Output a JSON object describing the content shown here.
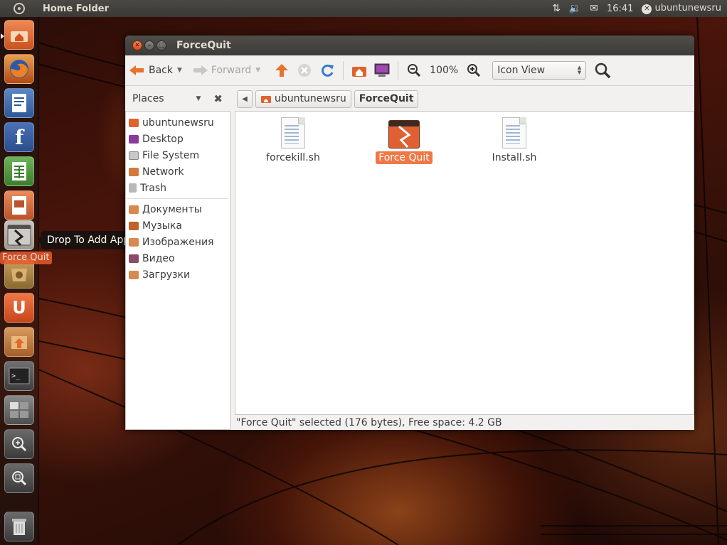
{
  "top_panel": {
    "title": "Home Folder",
    "time": "16:41",
    "user": "ubuntunewsru"
  },
  "launcher": {
    "tooltip": "Drop To Add Application",
    "drag_label": "Force Quit"
  },
  "window": {
    "title": "ForceQuit",
    "toolbar": {
      "back": "Back",
      "forward": "Forward",
      "zoom": "100%",
      "view": "Icon View"
    },
    "places_label": "Places",
    "breadcrumbs": [
      "ubuntunewsru",
      "ForceQuit"
    ],
    "places": [
      {
        "label": "ubuntunewsru",
        "icon": "home-folder-icon"
      },
      {
        "label": "Desktop",
        "icon": "desktop-icon"
      },
      {
        "label": "File System",
        "icon": "drive-icon"
      },
      {
        "label": "Network",
        "icon": "network-icon"
      },
      {
        "label": "Trash",
        "icon": "trash-icon"
      }
    ],
    "bookmarks": [
      {
        "label": "Документы",
        "icon": "documents-folder-icon"
      },
      {
        "label": "Музыка",
        "icon": "music-folder-icon"
      },
      {
        "label": "Изображения",
        "icon": "pictures-folder-icon"
      },
      {
        "label": "Видео",
        "icon": "video-folder-icon"
      },
      {
        "label": "Загрузки",
        "icon": "downloads-folder-icon"
      }
    ],
    "files": [
      {
        "name": "forcekill.sh",
        "icon": "script-file-icon",
        "selected": false
      },
      {
        "name": "Force Quit",
        "icon": "force-quit-app-icon",
        "selected": true
      },
      {
        "name": "Install.sh",
        "icon": "script-file-icon",
        "selected": false
      }
    ],
    "status": "\"Force Quit\" selected (176 bytes), Free space: 4.2 GB"
  },
  "colors": {
    "accent": "#f07746",
    "titlebar": "#3c3b37"
  }
}
